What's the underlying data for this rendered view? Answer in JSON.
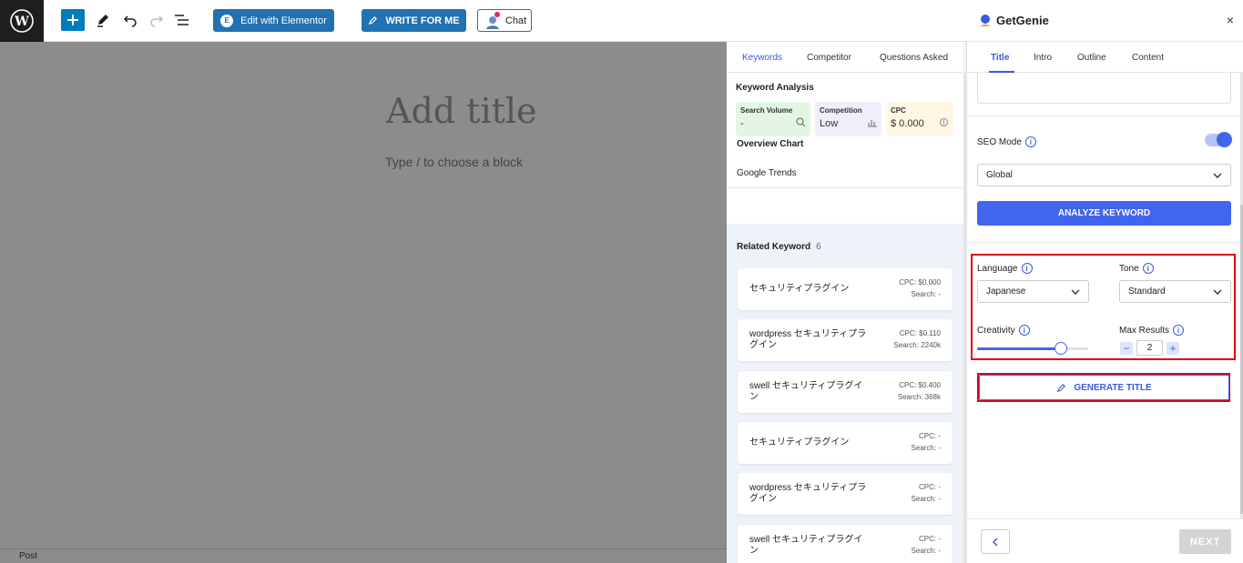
{
  "toolbar": {
    "elementor_label": "Edit with Elementor",
    "elementor_badge": "E",
    "write_label": "WRITE FOR ME",
    "chat_label": "Chat"
  },
  "editor": {
    "title_placeholder": "Add title",
    "block_hint": "Type / to choose a block",
    "status": "Post"
  },
  "keywords_panel": {
    "tabs": [
      "Keywords",
      "Competitor",
      "Questions Asked"
    ],
    "analysis_title": "Keyword Analysis",
    "metrics": [
      {
        "label": "Search Volume",
        "value": "-",
        "color": "#e3f6e3"
      },
      {
        "label": "Competition",
        "value": "Low",
        "color": "#f1eefb"
      },
      {
        "label": "CPC",
        "value": "$ 0.000",
        "color": "#fdf7e4"
      }
    ],
    "overview_chart": "Overview Chart",
    "google_trends": "Google Trends",
    "related_title": "Related Keyword",
    "related_count": "6",
    "related": [
      {
        "name": "セキュリティプラグイン",
        "cpc": "CPC: $0.000",
        "search": "Search: -"
      },
      {
        "name": "wordpress セキュリティプラグイン",
        "cpc": "CPC: $0.110",
        "search": "Search: 2240k"
      },
      {
        "name": "swell セキュリティプラグイン",
        "cpc": "CPC: $0.400",
        "search": "Search: 368k"
      },
      {
        "name": "セキュリティプラグイン",
        "cpc": "CPC: -",
        "search": "Search: -"
      },
      {
        "name": "wordpress セキュリティプラグイン",
        "cpc": "CPC: -",
        "search": "Search: -"
      },
      {
        "name": "swell セキュリティプラグイン",
        "cpc": "CPC: -",
        "search": "Search: -"
      }
    ]
  },
  "getgenie": {
    "brand": "GetGenie",
    "close": "×",
    "tabs": [
      "Title",
      "Intro",
      "Outline",
      "Content"
    ],
    "seo_mode_label": "SEO Mode",
    "region": "Global",
    "analyze_label": "ANALYZE KEYWORD",
    "language_label": "Language",
    "language_value": "Japanese",
    "tone_label": "Tone",
    "tone_value": "Standard",
    "creativity_label": "Creativity",
    "creativity_level": 0.75,
    "max_results_label": "Max Results",
    "max_results_value": "2",
    "minus": "−",
    "plus": "+",
    "generate_label": "GENERATE TITLE",
    "next_label": "NEXT",
    "accent": "#4265ef",
    "highlight": "#e0000f"
  }
}
